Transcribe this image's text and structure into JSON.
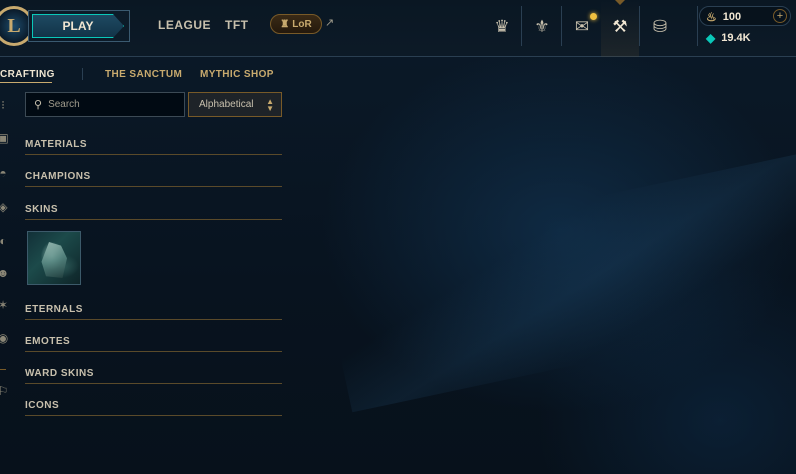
{
  "topbar": {
    "logo_letter": "L",
    "play_label": "PLAY",
    "nav": [
      "LEAGUE",
      "TFT"
    ],
    "lor_label": "LoR",
    "lor_glyph": "♜",
    "external_arrow": "↗",
    "icons": [
      {
        "name": "trophy-icon",
        "glyph": "♛"
      },
      {
        "name": "mastery-icon",
        "glyph": "⚜"
      },
      {
        "name": "chest-icon",
        "glyph": "✉"
      },
      {
        "name": "crafting-icon",
        "glyph": "⚒"
      },
      {
        "name": "store-icon",
        "glyph": "⛁"
      }
    ],
    "currency": {
      "rp_icon": "♨",
      "rp_value": "100",
      "be_icon": "◆",
      "be_value": "19.4K",
      "plus": "+"
    }
  },
  "subnav": {
    "crafting": "CRAFTING",
    "sanctum": "THE SANCTUM",
    "mythic_shop": "MYTHIC SHOP"
  },
  "rail_icons": [
    {
      "name": "grid-icon",
      "glyph": "⁝"
    },
    {
      "name": "card-icon",
      "glyph": "▣"
    },
    {
      "name": "helmet-icon",
      "glyph": "◓"
    },
    {
      "name": "shield-icon",
      "glyph": "◈"
    },
    {
      "name": "orb-icon",
      "glyph": "◐"
    },
    {
      "name": "emote-icon",
      "glyph": "☻"
    },
    {
      "name": "star-icon",
      "glyph": "✶"
    },
    {
      "name": "ward-icon",
      "glyph": "◉"
    },
    {
      "name": "wand-icon",
      "glyph": "⚐"
    }
  ],
  "search": {
    "placeholder": "Search",
    "icon": "⚲"
  },
  "sort": {
    "selected": "Alphabetical",
    "chev_up": "▲",
    "chev_down": "▼"
  },
  "categories": [
    "MATERIALS",
    "CHAMPIONS",
    "SKINS",
    "ETERNALS",
    "EMOTES",
    "WARD SKINS",
    "ICONS"
  ]
}
